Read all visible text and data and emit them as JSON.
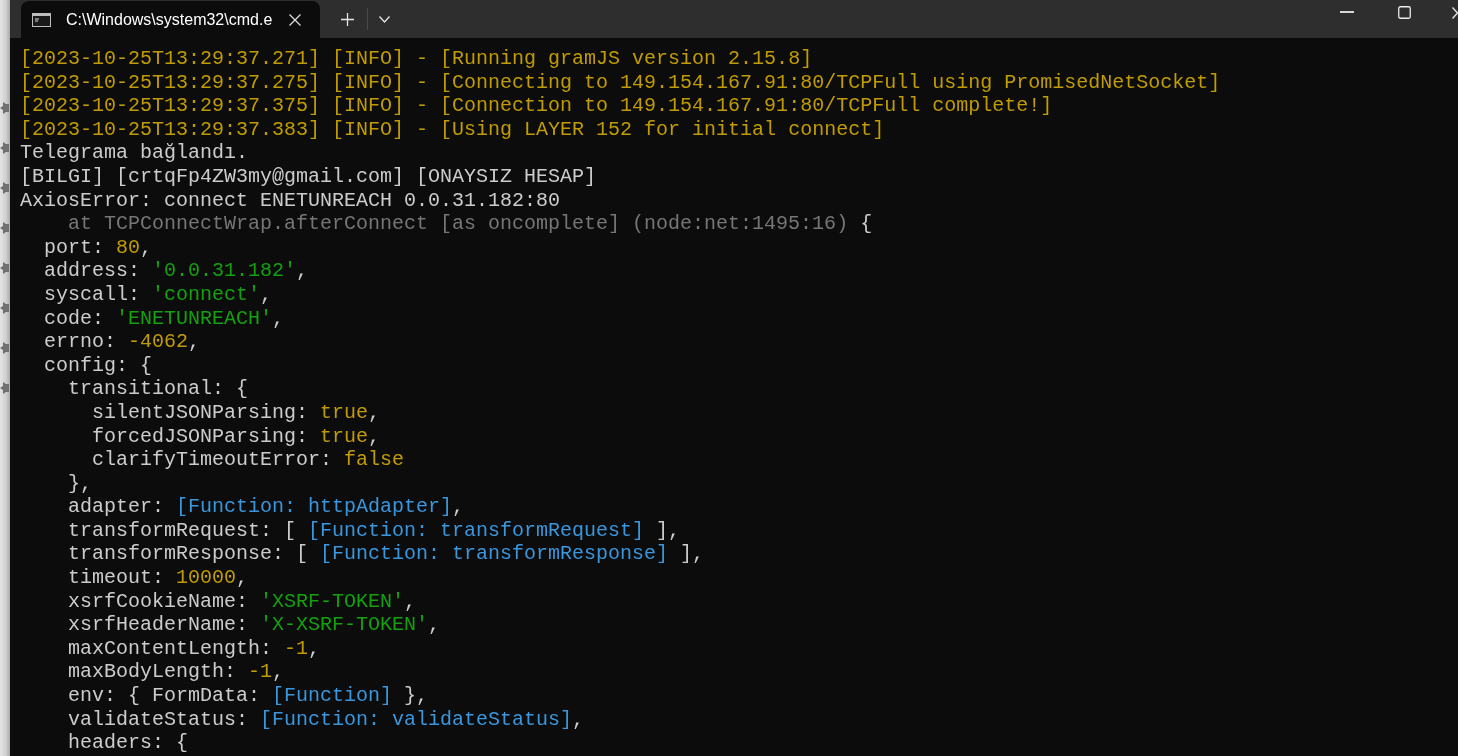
{
  "window": {
    "tabs": [
      {
        "title": "C:\\Windows\\system32\\cmd.e",
        "selected": true
      }
    ]
  },
  "console": {
    "lines": [
      [
        {
          "kind": "info",
          "text": "[2023-10-25T13:29:37.271] [INFO] - [Running gramJS version 2.15.8]"
        }
      ],
      [
        {
          "kind": "info",
          "text": "[2023-10-25T13:29:37.275] [INFO] - [Connecting to 149.154.167.91:80/TCPFull using PromisedNetSocket]"
        }
      ],
      [
        {
          "kind": "info",
          "text": "[2023-10-25T13:29:37.375] [INFO] - [Connection to 149.154.167.91:80/TCPFull complete!]"
        }
      ],
      [
        {
          "kind": "info",
          "text": "[2023-10-25T13:29:37.383] [INFO] - [Using LAYER 152 for initial connect]"
        }
      ],
      [
        {
          "kind": "plain",
          "text": "Telegrama bağlandı."
        }
      ],
      [
        {
          "kind": "plain",
          "text": "[BILGI] [crtqFp4ZW3my@gmail.com] [ONAYSIZ HESAP]"
        }
      ],
      [
        {
          "kind": "plain",
          "text": "AxiosError: connect ENETUNREACH 0.0.31.182:80"
        }
      ],
      [
        {
          "kind": "dim",
          "text": "    at TCPConnectWrap.afterConnect [as oncomplete] (node:net:1495:16)"
        },
        {
          "kind": "plain",
          "text": " {"
        }
      ],
      [
        {
          "kind": "plain",
          "text": "  port: "
        },
        {
          "kind": "number",
          "text": "80"
        },
        {
          "kind": "plain",
          "text": ","
        }
      ],
      [
        {
          "kind": "plain",
          "text": "  address: "
        },
        {
          "kind": "string",
          "text": "'0.0.31.182'"
        },
        {
          "kind": "plain",
          "text": ","
        }
      ],
      [
        {
          "kind": "plain",
          "text": "  syscall: "
        },
        {
          "kind": "string",
          "text": "'connect'"
        },
        {
          "kind": "plain",
          "text": ","
        }
      ],
      [
        {
          "kind": "plain",
          "text": "  code: "
        },
        {
          "kind": "string",
          "text": "'ENETUNREACH'"
        },
        {
          "kind": "plain",
          "text": ","
        }
      ],
      [
        {
          "kind": "plain",
          "text": "  errno: "
        },
        {
          "kind": "number",
          "text": "-4062"
        },
        {
          "kind": "plain",
          "text": ","
        }
      ],
      [
        {
          "kind": "plain",
          "text": "  config: {"
        }
      ],
      [
        {
          "kind": "plain",
          "text": "    transitional: {"
        }
      ],
      [
        {
          "kind": "plain",
          "text": "      silentJSONParsing: "
        },
        {
          "kind": "boolean",
          "text": "true"
        },
        {
          "kind": "plain",
          "text": ","
        }
      ],
      [
        {
          "kind": "plain",
          "text": "      forcedJSONParsing: "
        },
        {
          "kind": "boolean",
          "text": "true"
        },
        {
          "kind": "plain",
          "text": ","
        }
      ],
      [
        {
          "kind": "plain",
          "text": "      clarifyTimeoutError: "
        },
        {
          "kind": "boolean",
          "text": "false"
        }
      ],
      [
        {
          "kind": "plain",
          "text": "    },"
        }
      ],
      [
        {
          "kind": "plain",
          "text": "    adapter: "
        },
        {
          "kind": "function",
          "text": "[Function: httpAdapter]"
        },
        {
          "kind": "plain",
          "text": ","
        }
      ],
      [
        {
          "kind": "plain",
          "text": "    transformRequest: [ "
        },
        {
          "kind": "function",
          "text": "[Function: transformRequest]"
        },
        {
          "kind": "plain",
          "text": " ],"
        }
      ],
      [
        {
          "kind": "plain",
          "text": "    transformResponse: [ "
        },
        {
          "kind": "function",
          "text": "[Function: transformResponse]"
        },
        {
          "kind": "plain",
          "text": " ],"
        }
      ],
      [
        {
          "kind": "plain",
          "text": "    timeout: "
        },
        {
          "kind": "number",
          "text": "10000"
        },
        {
          "kind": "plain",
          "text": ","
        }
      ],
      [
        {
          "kind": "plain",
          "text": "    xsrfCookieName: "
        },
        {
          "kind": "string",
          "text": "'XSRF-TOKEN'"
        },
        {
          "kind": "plain",
          "text": ","
        }
      ],
      [
        {
          "kind": "plain",
          "text": "    xsrfHeaderName: "
        },
        {
          "kind": "string",
          "text": "'X-XSRF-TOKEN'"
        },
        {
          "kind": "plain",
          "text": ","
        }
      ],
      [
        {
          "kind": "plain",
          "text": "    maxContentLength: "
        },
        {
          "kind": "number",
          "text": "-1"
        },
        {
          "kind": "plain",
          "text": ","
        }
      ],
      [
        {
          "kind": "plain",
          "text": "    maxBodyLength: "
        },
        {
          "kind": "number",
          "text": "-1"
        },
        {
          "kind": "plain",
          "text": ","
        }
      ],
      [
        {
          "kind": "plain",
          "text": "    env: { FormData: "
        },
        {
          "kind": "function",
          "text": "[Function]"
        },
        {
          "kind": "plain",
          "text": " },"
        }
      ],
      [
        {
          "kind": "plain",
          "text": "    validateStatus: "
        },
        {
          "kind": "function",
          "text": "[Function: validateStatus]"
        },
        {
          "kind": "plain",
          "text": ","
        }
      ],
      [
        {
          "kind": "plain",
          "text": "    headers: {"
        }
      ]
    ]
  }
}
